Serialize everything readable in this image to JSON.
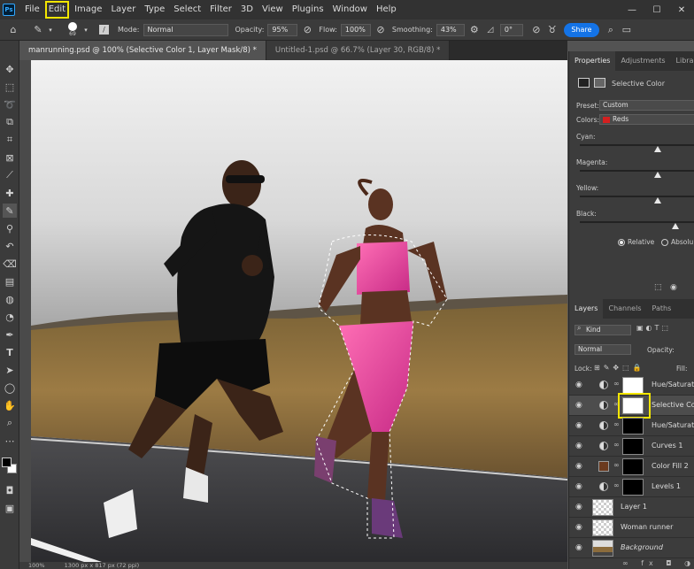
{
  "menu": {
    "logo": "Ps",
    "items": [
      "File",
      "Edit",
      "Image",
      "Layer",
      "Type",
      "Select",
      "Filter",
      "3D",
      "View",
      "Plugins",
      "Window",
      "Help"
    ]
  },
  "options": {
    "brush_size": "69",
    "mode_label": "Mode:",
    "mode_value": "Normal",
    "opacity_label": "Opacity:",
    "opacity_value": "95%",
    "flow_label": "Flow:",
    "flow_value": "100%",
    "smoothing_label": "Smoothing:",
    "smoothing_value": "43%",
    "angle_value": "0°",
    "share_label": "Share"
  },
  "tabs": [
    {
      "label": "manrunning.psd @ 100% (Selective Color 1, Layer Mask/8) *",
      "active": true
    },
    {
      "label": "Untitled-1.psd @ 66.7% (Layer 30, RGB/8) *",
      "active": false
    }
  ],
  "status": {
    "zoom": "100%",
    "doc_size": "1300 px x 817 px (72 ppi)"
  },
  "properties": {
    "tabs": [
      "Properties",
      "Adjustments",
      "Librarie"
    ],
    "title": "Selective Color",
    "preset_label": "Preset:",
    "preset_value": "Custom",
    "colors_label": "Colors:",
    "colors_value": "Reds",
    "sliders": [
      {
        "label": "Cyan:",
        "value": 0
      },
      {
        "label": "Magenta:",
        "value": 0
      },
      {
        "label": "Yellow:",
        "value": 0
      },
      {
        "label": "Black:",
        "value": 0
      }
    ],
    "relative_label": "Relative",
    "absolute_label": "Absolu"
  },
  "layers_panel": {
    "tabs": [
      "Layers",
      "Channels",
      "Paths"
    ],
    "kind_label": "Kind",
    "blend_mode": "Normal",
    "opacity_label": "Opacity:",
    "lock_label": "Lock:",
    "fill_label": "Fill:",
    "layers": [
      {
        "name": "Hue/Saturation",
        "type": "adjustment",
        "mask": "white"
      },
      {
        "name": "Selective Color",
        "type": "adjustment",
        "mask": "white",
        "selected": true
      },
      {
        "name": "Hue/Saturation",
        "type": "adjustment",
        "mask": "black"
      },
      {
        "name": "Curves 1",
        "type": "adjustment",
        "mask": "black"
      },
      {
        "name": "Color Fill 2",
        "type": "fill",
        "mask": "black"
      },
      {
        "name": "Levels 1",
        "type": "adjustment",
        "mask": "black"
      },
      {
        "name": "Layer 1",
        "type": "pixel"
      },
      {
        "name": "Woman runner",
        "type": "pixel"
      },
      {
        "name": "Background",
        "type": "background"
      }
    ]
  },
  "colors": {
    "accent": "#1473e6",
    "highlight": "#f3e600",
    "reds_swatch": "#d42020"
  }
}
